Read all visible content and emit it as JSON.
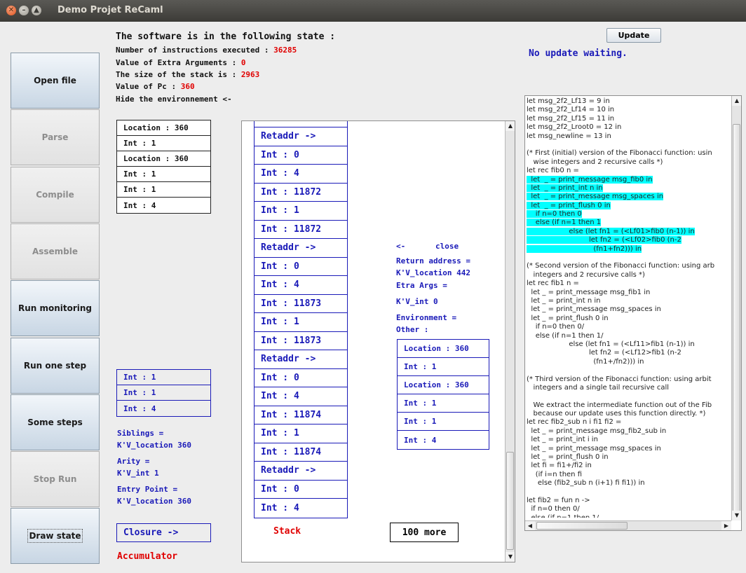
{
  "window": {
    "title": "Demo Projet ReCaml"
  },
  "sidebar": {
    "buttons": [
      {
        "label": "Open file",
        "enabled": true
      },
      {
        "label": "Parse",
        "enabled": false
      },
      {
        "label": "Compile",
        "enabled": false
      },
      {
        "label": "Assemble",
        "enabled": false
      },
      {
        "label": "Run monitoring",
        "enabled": true
      },
      {
        "label": "Run one step",
        "enabled": true
      },
      {
        "label": "Some steps",
        "enabled": true
      },
      {
        "label": "Stop Run",
        "enabled": false
      },
      {
        "label": "Draw state",
        "enabled": true
      }
    ]
  },
  "state": {
    "title": "The software is in the following state :",
    "instructions_label": "Number of instructions executed : ",
    "instructions_value": "36285",
    "extra_args_label": "Value of Extra Arguments : ",
    "extra_args_value": "0",
    "stack_size_label": "The size of the stack is : ",
    "stack_size_value": "2963",
    "pc_label": "Value of Pc : ",
    "pc_value": "360",
    "hide_env": "Hide the environnement <-"
  },
  "environment": [
    "Location : 360",
    "Int : 1",
    "Location : 360",
    "Int : 1",
    "Int : 1",
    "Int : 4"
  ],
  "accumulator": {
    "closure_values": [
      "Int : 1",
      "Int : 1",
      "Int : 4"
    ],
    "siblings_label": "Siblings =",
    "siblings_value": "K'V_location 360",
    "arity_label": "Arity =",
    "arity_value": "K'V_int 1",
    "entry_label": "Entry Point =",
    "entry_value": "K'V_location 360",
    "closure_button": "Closure ->",
    "label": "Accumulator"
  },
  "stack": {
    "cells": [
      "",
      "Retaddr ->",
      "Int : 0",
      "Int : 4",
      "Int : 11872",
      "Int : 1",
      "Int : 11872",
      "Retaddr ->",
      "Int : 0",
      "Int : 4",
      "Int : 11873",
      "Int : 1",
      "Int : 11873",
      "Retaddr ->",
      "Int : 0",
      "Int : 4",
      "Int : 11874",
      "Int : 1",
      "Int : 11874",
      "Retaddr ->",
      "Int : 0",
      "Int : 4"
    ],
    "label": "Stack",
    "more_button": "100 more"
  },
  "retaddr_detail": {
    "close_arrow": "<-",
    "close_label": "close",
    "return_label": "Return address =",
    "return_value": "K'V_location 442",
    "extra_label": "Etra Args =",
    "extra_value": "K'V_int 0",
    "env_label": "Environment =",
    "other_label": "Other :",
    "env_values": [
      "Location : 360",
      "Int : 1",
      "Location : 360",
      "Int : 1",
      "Int : 1",
      "Int : 4"
    ]
  },
  "update": {
    "button": "Update",
    "status": "No update waiting."
  },
  "code": {
    "lines": [
      {
        "text": "let msg_2f2_Lf13 = 9 in",
        "hl": false
      },
      {
        "text": "let msg_2f2_Lf14 = 10 in",
        "hl": false
      },
      {
        "text": "let msg_2f2_Lf15 = 11 in",
        "hl": false
      },
      {
        "text": "let msg_2f2_Lroot0 = 12 in",
        "hl": false
      },
      {
        "text": "let msg_newline = 13 in",
        "hl": false
      },
      {
        "text": "",
        "hl": false
      },
      {
        "text": "(* First (initial) version of the Fibonacci function: usin",
        "hl": false
      },
      {
        "text": "   wise integers and 2 recursive calls *)",
        "hl": false
      },
      {
        "text": "let rec fib0 n =",
        "hl": false
      },
      {
        "text": "  let  _ = print_message msg_fib0 in",
        "hl": true
      },
      {
        "text": "  let  _ = print_int n in",
        "hl": true
      },
      {
        "text": "  let  _ = print_message msg_spaces in",
        "hl": true
      },
      {
        "text": "  let  _ = print_flush 0 in",
        "hl": true
      },
      {
        "text": "    if n=0 then 0",
        "hl": true
      },
      {
        "text": "    else (if n=1 then 1",
        "hl": true
      },
      {
        "text": "                   else (let fn1 = (<Lf01>fib0 (n-1)) in",
        "hl": true
      },
      {
        "text": "                            let fn2 = (<Lf02>fib0 (n-2",
        "hl": true
      },
      {
        "text": "                              (fn1+fn2))) in",
        "hl": true
      },
      {
        "text": "",
        "hl": false
      },
      {
        "text": "(* Second version of the Fibonacci function: using arb",
        "hl": false
      },
      {
        "text": "   integers and 2 recursive calls *)",
        "hl": false
      },
      {
        "text": "let rec fib1 n =",
        "hl": false
      },
      {
        "text": "  let _ = print_message msg_fib1 in",
        "hl": false
      },
      {
        "text": "  let _ = print_int n in",
        "hl": false
      },
      {
        "text": "  let _ = print_message msg_spaces in",
        "hl": false
      },
      {
        "text": "  let _ = print_flush 0 in",
        "hl": false
      },
      {
        "text": "    if n=0 then 0/",
        "hl": false
      },
      {
        "text": "    else (if n=1 then 1/",
        "hl": false
      },
      {
        "text": "                   else (let fn1 = (<Lf11>fib1 (n-1)) in",
        "hl": false
      },
      {
        "text": "                            let fn2 = (<Lf12>fib1 (n-2",
        "hl": false
      },
      {
        "text": "                              (fn1+/fn2))) in",
        "hl": false
      },
      {
        "text": "",
        "hl": false
      },
      {
        "text": "(* Third version of the Fibonacci function: using arbit",
        "hl": false
      },
      {
        "text": "   integers and a single tail recursive call",
        "hl": false
      },
      {
        "text": "",
        "hl": false
      },
      {
        "text": "   We extract the intermediate function out of the Fib",
        "hl": false
      },
      {
        "text": "   because our update uses this function directly. *)",
        "hl": false
      },
      {
        "text": "let rec fib2_sub n i fi1 fi2 =",
        "hl": false
      },
      {
        "text": "  let _ = print_message msg_fib2_sub in",
        "hl": false
      },
      {
        "text": "  let _ = print_int i in",
        "hl": false
      },
      {
        "text": "  let _ = print_message msg_spaces in",
        "hl": false
      },
      {
        "text": "  let _ = print_flush 0 in",
        "hl": false
      },
      {
        "text": "  let fi = fi1+/fi2 in",
        "hl": false
      },
      {
        "text": "    (if i=n then fi",
        "hl": false
      },
      {
        "text": "     else (fib2_sub n (i+1) fi fi1)) in",
        "hl": false
      },
      {
        "text": "",
        "hl": false
      },
      {
        "text": "let fib2 = fun n ->",
        "hl": false
      },
      {
        "text": "  if n=0 then 0/",
        "hl": false
      },
      {
        "text": "  else (if n=1 then 1/",
        "hl": false
      }
    ]
  },
  "icons": {
    "close": "close-icon",
    "minimize": "minimize-icon",
    "maximize": "maximize-icon"
  }
}
